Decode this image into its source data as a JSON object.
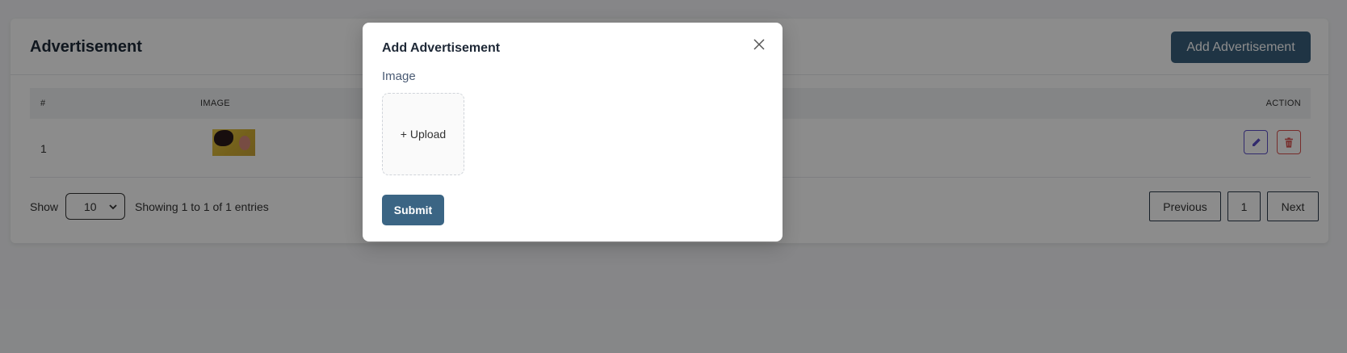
{
  "page": {
    "title": "Advertisement",
    "add_button": "Add Advertisement"
  },
  "table": {
    "columns": [
      "#",
      "IMAGE",
      "ACTION"
    ],
    "rows": [
      {
        "index": "1",
        "image": "advertisement-thumbnail"
      }
    ]
  },
  "footer": {
    "show_label": "Show",
    "page_size": "10",
    "entries_text": "Showing 1 to 1 of 1 entries",
    "pagination": {
      "previous": "Previous",
      "current": "1",
      "next": "Next"
    }
  },
  "modal": {
    "title": "Add Advertisement",
    "field_label": "Image",
    "upload_label": "+ Upload",
    "submit_label": "Submit"
  },
  "icons": {
    "close": "close-icon",
    "edit": "pencil-icon",
    "delete": "trash-icon",
    "select": "chevron-down-icon"
  },
  "colors": {
    "primary": "#3a5f7d",
    "submit": "#3b6584",
    "edit": "#5b4fc7",
    "delete": "#d9534f"
  }
}
